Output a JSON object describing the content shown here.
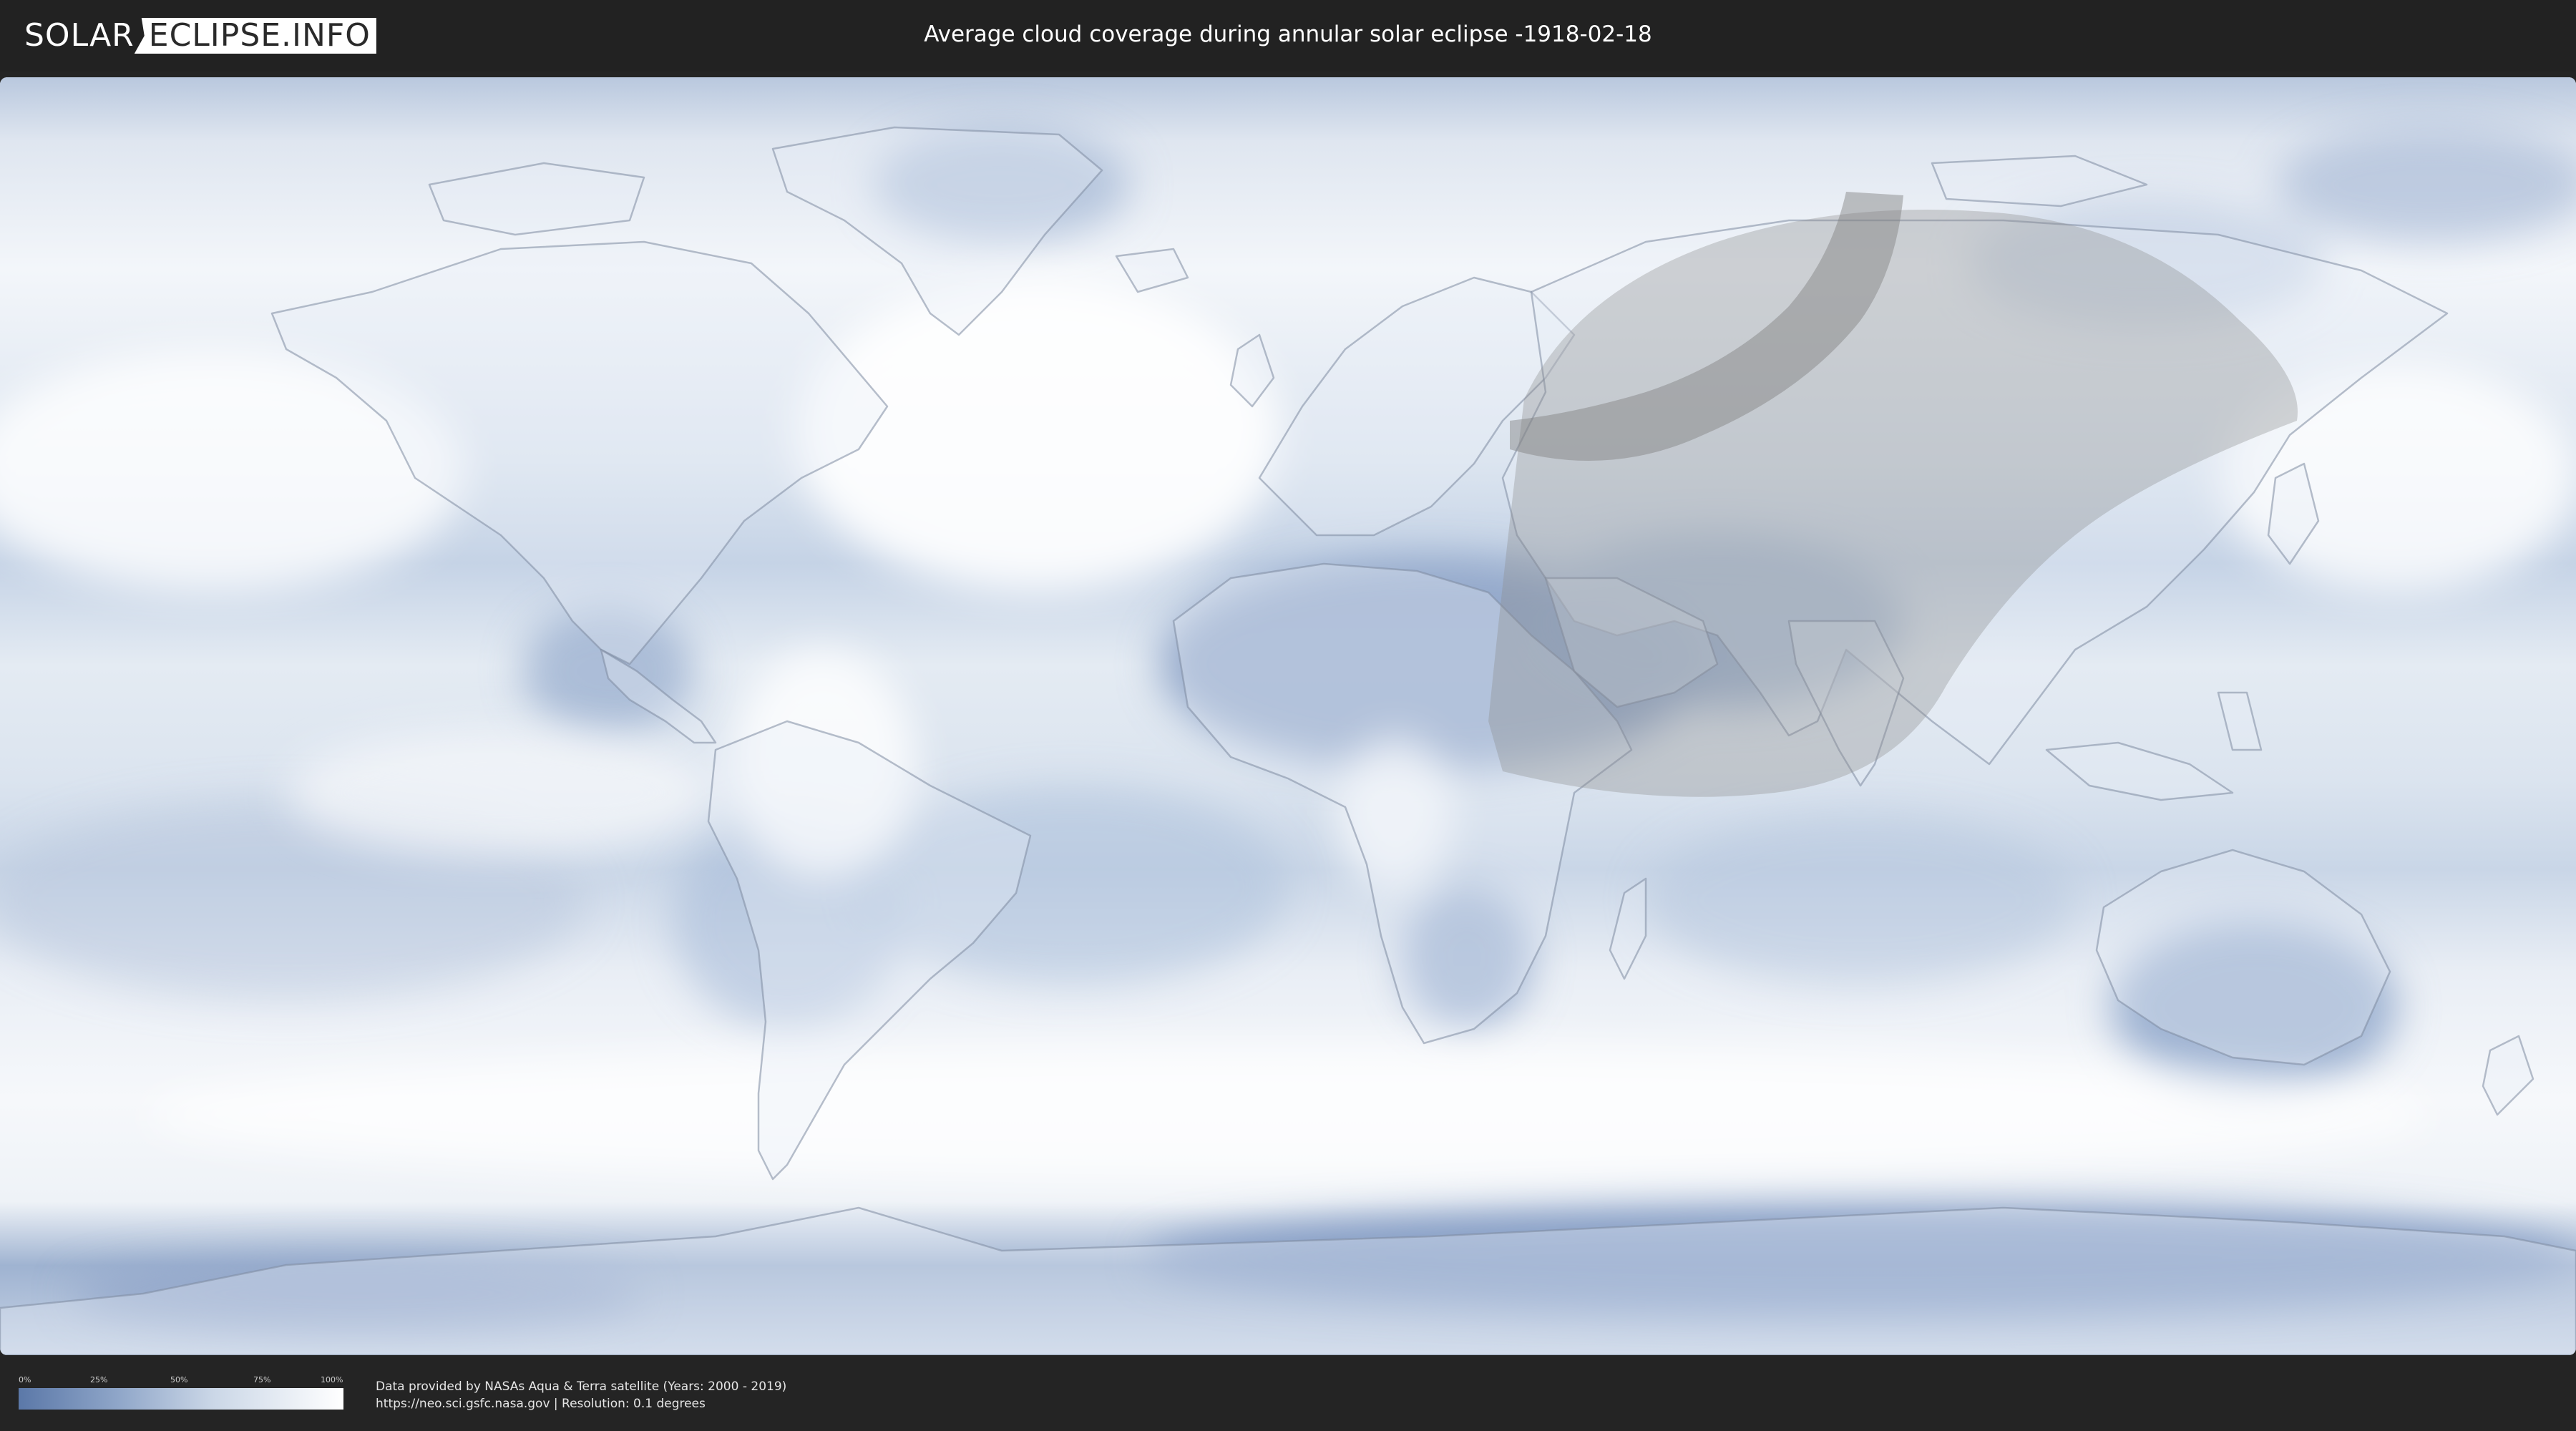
{
  "header": {
    "logo_part1": "SOLAR",
    "logo_part2": "ECLIPSE.INFO",
    "title": "Average cloud coverage during annular solar eclipse -1918-02-18"
  },
  "legend": {
    "ticks": [
      "0%",
      "25%",
      "50%",
      "75%",
      "100%"
    ],
    "color_low": "#5b78a8",
    "color_high": "#ffffff"
  },
  "credits": {
    "line1": "Data provided by NASAs Aqua & Terra satellite (Years: 2000 - 2019)",
    "line2": "https://neo.sci.gsfc.nasa.gov | Resolution: 0.1 degrees"
  },
  "colors": {
    "header_bg": "#222222",
    "ocean_clear": "#7f98c2",
    "cloudy": "#f4f7fb",
    "eclipse_shadow": "#8c8c8c"
  }
}
